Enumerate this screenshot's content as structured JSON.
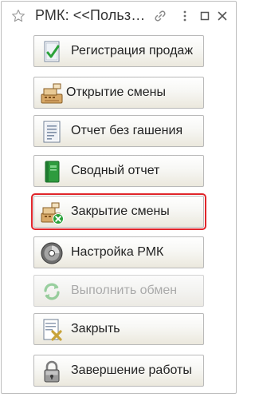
{
  "window": {
    "title": "РМК: <<Польз…"
  },
  "buttons": [
    {
      "label": "Регистрация продаж",
      "icon": "cash-register-check-icon"
    },
    {
      "label": "Открытие смены",
      "icon": "cash-register-open-icon"
    },
    {
      "label": "Отчет без гашения",
      "icon": "report-document-icon"
    },
    {
      "label": "Сводный отчет",
      "icon": "green-book-icon"
    },
    {
      "label": "Закрытие смены",
      "icon": "cash-register-close-icon",
      "state": "selected"
    },
    {
      "label": "Настройка РМК",
      "icon": "settings-disc-icon"
    },
    {
      "label": "Выполнить обмен",
      "icon": "sync-icon",
      "state": "disabled"
    },
    {
      "label": "Закрыть",
      "icon": "close-document-icon"
    },
    {
      "label": "Завершение работы",
      "icon": "padlock-icon"
    }
  ],
  "colors": {
    "selection_outline": "#e0262b",
    "button_border": "#b9b9b9",
    "disabled_text": "#aaaaaa"
  }
}
